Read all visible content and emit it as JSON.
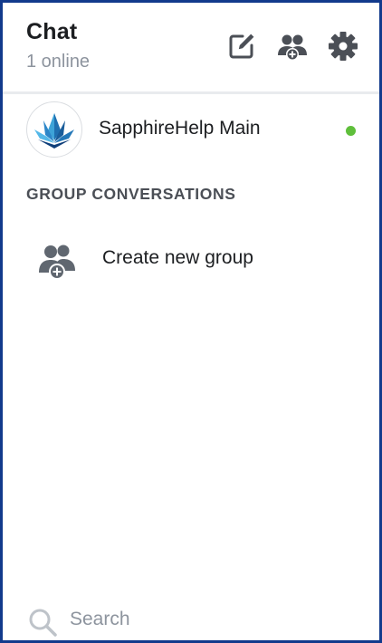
{
  "header": {
    "title": "Chat",
    "subtitle": "1 online",
    "icons": [
      "compose-icon",
      "add-group-icon",
      "gear-icon"
    ]
  },
  "contacts": [
    {
      "name": "SapphireHelp Main",
      "status": "online",
      "status_color": "#5fbf3b"
    }
  ],
  "groups": {
    "section_label": "GROUP CONVERSATIONS",
    "create_label": "Create new group"
  },
  "search": {
    "placeholder": "Search",
    "value": ""
  },
  "colors": {
    "frame_border": "#123a8c",
    "icon": "#4b4f56",
    "muted_text": "#8d949e",
    "online": "#5fbf3b"
  }
}
